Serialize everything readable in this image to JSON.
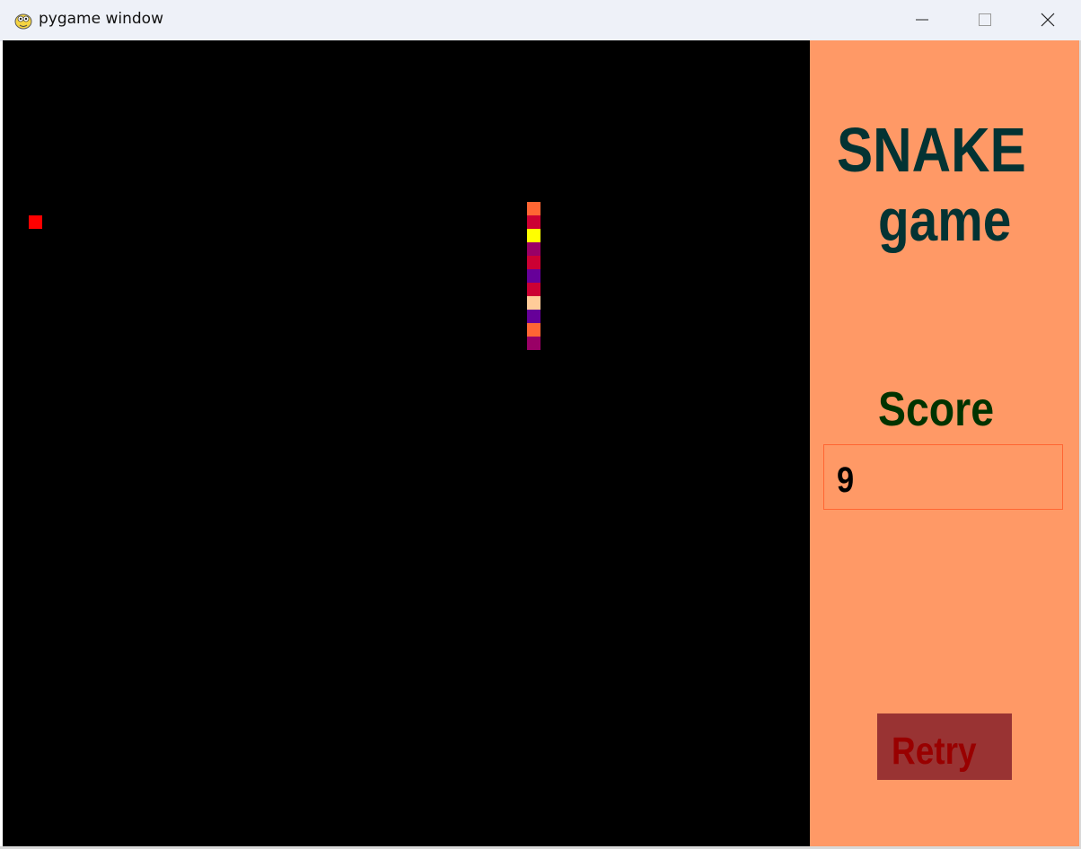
{
  "window": {
    "title": "pygame window",
    "icon": "pygame-snake-icon",
    "controls": [
      "minimize-icon",
      "maximize-icon",
      "close-icon"
    ]
  },
  "board": {
    "background": "#000000",
    "food": {
      "color": "#ff0000"
    },
    "snake_segment_colors": [
      "#ff6633",
      "#cc0033",
      "#ffff00",
      "#990066",
      "#cc0033",
      "#660099",
      "#cc0033",
      "#ffcc99",
      "#660099",
      "#ff6633",
      "#990066"
    ]
  },
  "panel": {
    "background": "#ff9966",
    "title_line1": "SNAKE",
    "title_line2": "game",
    "score_label": "Score",
    "score_value": "9",
    "retry_label": "Retry",
    "colors": {
      "title": "#033333",
      "score_label": "#003300",
      "retry_bg": "#993333",
      "retry_text": "#990000",
      "score_border": "#ff6633"
    }
  }
}
